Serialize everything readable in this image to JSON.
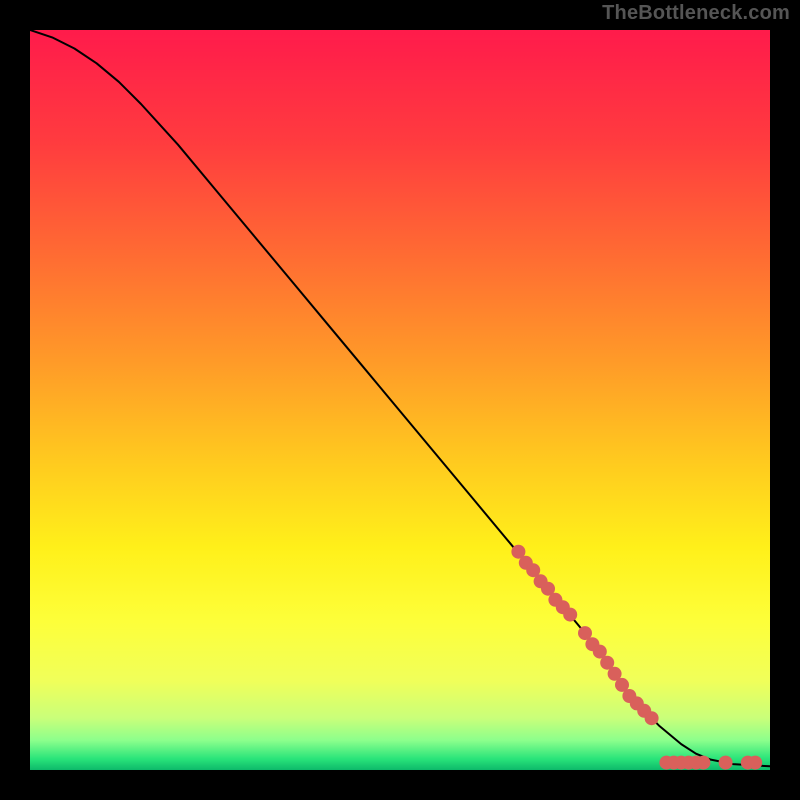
{
  "watermark": "TheBottleneck.com",
  "chart_data": {
    "type": "line",
    "title": "",
    "xlabel": "",
    "ylabel": "",
    "xlim": [
      0,
      100
    ],
    "ylim": [
      0,
      100
    ],
    "gradient_stops": [
      {
        "offset": 0.0,
        "color": "#ff1b4b"
      },
      {
        "offset": 0.15,
        "color": "#ff3b3f"
      },
      {
        "offset": 0.3,
        "color": "#ff6a33"
      },
      {
        "offset": 0.45,
        "color": "#ff9b28"
      },
      {
        "offset": 0.58,
        "color": "#ffc91f"
      },
      {
        "offset": 0.7,
        "color": "#fff01a"
      },
      {
        "offset": 0.8,
        "color": "#fdff3a"
      },
      {
        "offset": 0.88,
        "color": "#f0ff5a"
      },
      {
        "offset": 0.93,
        "color": "#c9ff7a"
      },
      {
        "offset": 0.96,
        "color": "#8cff8c"
      },
      {
        "offset": 0.985,
        "color": "#29e47a"
      },
      {
        "offset": 1.0,
        "color": "#0db96a"
      }
    ],
    "series": [
      {
        "name": "curve",
        "x": [
          0,
          3,
          6,
          9,
          12,
          15,
          20,
          25,
          30,
          35,
          40,
          45,
          50,
          55,
          60,
          65,
          70,
          75,
          78,
          80,
          82,
          85,
          88,
          90,
          92,
          95,
          100
        ],
        "y": [
          100,
          99,
          97.5,
          95.5,
          93,
          90,
          84.5,
          78.5,
          72.5,
          66.5,
          60.5,
          54.5,
          48.5,
          42.5,
          36.5,
          30.5,
          24.5,
          18.5,
          14.5,
          11.5,
          9,
          6,
          3.5,
          2.2,
          1.4,
          0.8,
          0.5
        ],
        "stroke": "#000000",
        "width": 2
      }
    ],
    "markers": {
      "color": "#d9605b",
      "radius": 7,
      "points": [
        {
          "x": 66,
          "y": 29.5
        },
        {
          "x": 67,
          "y": 28.0
        },
        {
          "x": 68,
          "y": 27.0
        },
        {
          "x": 69,
          "y": 25.5
        },
        {
          "x": 70,
          "y": 24.5
        },
        {
          "x": 71,
          "y": 23.0
        },
        {
          "x": 72,
          "y": 22.0
        },
        {
          "x": 73,
          "y": 21.0
        },
        {
          "x": 75,
          "y": 18.5
        },
        {
          "x": 76,
          "y": 17.0
        },
        {
          "x": 77,
          "y": 16.0
        },
        {
          "x": 78,
          "y": 14.5
        },
        {
          "x": 79,
          "y": 13.0
        },
        {
          "x": 80,
          "y": 11.5
        },
        {
          "x": 81,
          "y": 10.0
        },
        {
          "x": 82,
          "y": 9.0
        },
        {
          "x": 83,
          "y": 8.0
        },
        {
          "x": 84,
          "y": 7.0
        },
        {
          "x": 86,
          "y": 1.0
        },
        {
          "x": 87,
          "y": 1.0
        },
        {
          "x": 88,
          "y": 1.0
        },
        {
          "x": 89,
          "y": 1.0
        },
        {
          "x": 90,
          "y": 1.0
        },
        {
          "x": 91,
          "y": 1.0
        },
        {
          "x": 94,
          "y": 1.0
        },
        {
          "x": 97,
          "y": 1.0
        },
        {
          "x": 98,
          "y": 1.0
        }
      ]
    }
  }
}
